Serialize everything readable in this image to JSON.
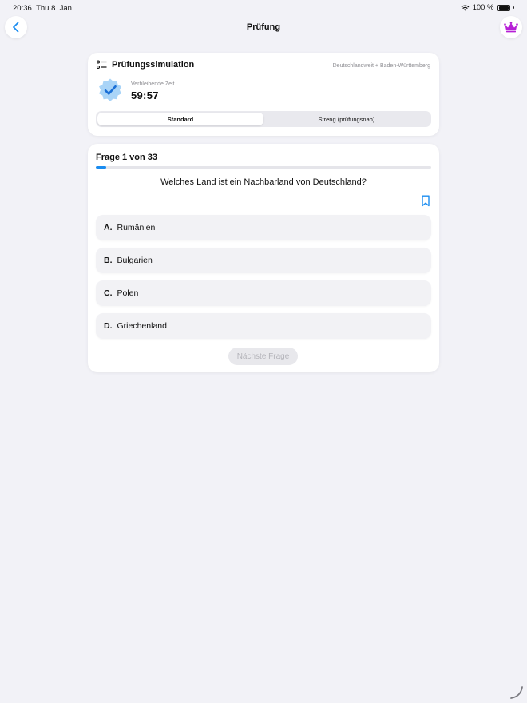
{
  "status_bar": {
    "time": "20:36",
    "date": "Thu 8. Jan",
    "battery": "100 %"
  },
  "nav": {
    "title": "Prüfung"
  },
  "simulation": {
    "title": "Prüfungssimulation",
    "region": "Deutschlandweit + Baden-Württemberg",
    "timer_label": "Verbleibende Zeit",
    "timer_value": "59:57",
    "modes": [
      {
        "label": "Standard",
        "selected": true
      },
      {
        "label": "Streng (prüfungsnah)",
        "selected": false
      }
    ]
  },
  "quiz": {
    "progress_label": "Frage 1 von 33",
    "progress_fraction": 0.03,
    "question": "Welches Land ist ein Nachbarland von Deutschland?",
    "answers": [
      {
        "letter": "A.",
        "text": "Rumänien"
      },
      {
        "letter": "B.",
        "text": "Bulgarien"
      },
      {
        "letter": "C.",
        "text": "Polen"
      },
      {
        "letter": "D.",
        "text": "Griechenland"
      }
    ],
    "next_label": "Nächste Frage"
  },
  "colors": {
    "accent": "#1a8cf0",
    "crown": "#b620d6",
    "badge": "#a9d4f7"
  },
  "icons": {
    "back": "chevron-left-icon",
    "premium": "crown-icon",
    "list": "checklist-icon",
    "badge": "verified-badge-icon",
    "bookmark": "bookmark-icon"
  }
}
